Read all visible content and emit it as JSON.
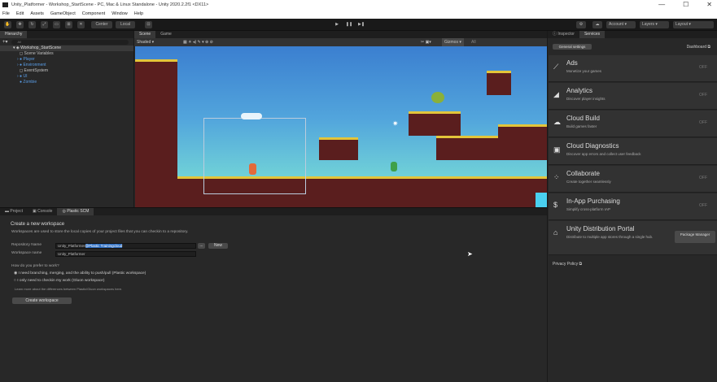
{
  "window": {
    "title": "Unity_Platformer - Workshop_StartScene - PC, Mac & Linux Standalone - Unity 2020.2.2f1 <DX11>",
    "controls": [
      "—",
      "☐",
      "✕"
    ]
  },
  "menu": [
    "File",
    "Edit",
    "Assets",
    "GameObject",
    "Component",
    "Window",
    "Help"
  ],
  "toolbar": {
    "center": "Center",
    "local": "Local",
    "account": "Account",
    "layers": "Layers",
    "layout": "Layout"
  },
  "hierarchy": {
    "tab": "Hierarchy",
    "search_placeholder": "All",
    "items": [
      {
        "label": "Workshop_StartScene",
        "level": 0,
        "type": "scene"
      },
      {
        "label": "Scene Variables",
        "level": 1,
        "type": "object"
      },
      {
        "label": "Player",
        "level": 1,
        "type": "prefab"
      },
      {
        "label": "Environment",
        "level": 1,
        "type": "prefab"
      },
      {
        "label": "EventSystem",
        "level": 1,
        "type": "object"
      },
      {
        "label": "UI",
        "level": 1,
        "type": "prefab"
      },
      {
        "label": "Zombie",
        "level": 1,
        "type": "prefab"
      }
    ]
  },
  "scene": {
    "tabs": [
      "Scene",
      "Game"
    ],
    "shading": "Shaded",
    "gizmos": "Gizmos",
    "search": "All"
  },
  "bottom": {
    "tabs": [
      "Project",
      "Console",
      "Plastic SCM"
    ],
    "heading": "Create a new workspace",
    "desc": "Workspaces are used to store the local copies of your project files that you can checkin to a repository.",
    "repo_label": "Repository Name",
    "repo_value_plain": "Unity_Platformer",
    "repo_value_selected": "@Plastic Trainingcloud",
    "ws_label": "Workspace name",
    "ws_value": "Unity_Platformer",
    "new_button": "New",
    "browse_button": "...",
    "question": "How do you prefer to work?",
    "options": [
      "I need branching, merging, and the ability to push/pull (Plastic workspace)",
      "I only need to checkin my work (Gluon workspace)"
    ],
    "learn_more": "Learn more about the differences between Plastic/Gluon workspaces here.",
    "create_button": "Create workspace"
  },
  "inspector": {
    "tabs": [
      "Inspector",
      "Services"
    ],
    "general_settings": "General settings",
    "dashboard": "Dashboard",
    "services": [
      {
        "title": "Ads",
        "desc": "Monetize your games",
        "state": "OFF",
        "icon": "⟋"
      },
      {
        "title": "Analytics",
        "desc": "Discover player insights",
        "state": "OFF",
        "icon": "◢"
      },
      {
        "title": "Cloud Build",
        "desc": "Build games faster",
        "state": "OFF",
        "icon": "☁"
      },
      {
        "title": "Cloud Diagnostics",
        "desc": "Discover app errors and collect user feedback",
        "state": "",
        "icon": "▣"
      },
      {
        "title": "Collaborate",
        "desc": "Create together seamlessly",
        "state": "OFF",
        "icon": "⁘"
      },
      {
        "title": "In-App Purchasing",
        "desc": "Simplify cross-platform IAP",
        "state": "OFF",
        "icon": "$"
      }
    ],
    "portal": {
      "title": "Unity Distribution Portal",
      "desc": "Distribute to multiple app stores through a single hub.",
      "button": "Package Manager"
    },
    "privacy": "Privacy Policy"
  }
}
